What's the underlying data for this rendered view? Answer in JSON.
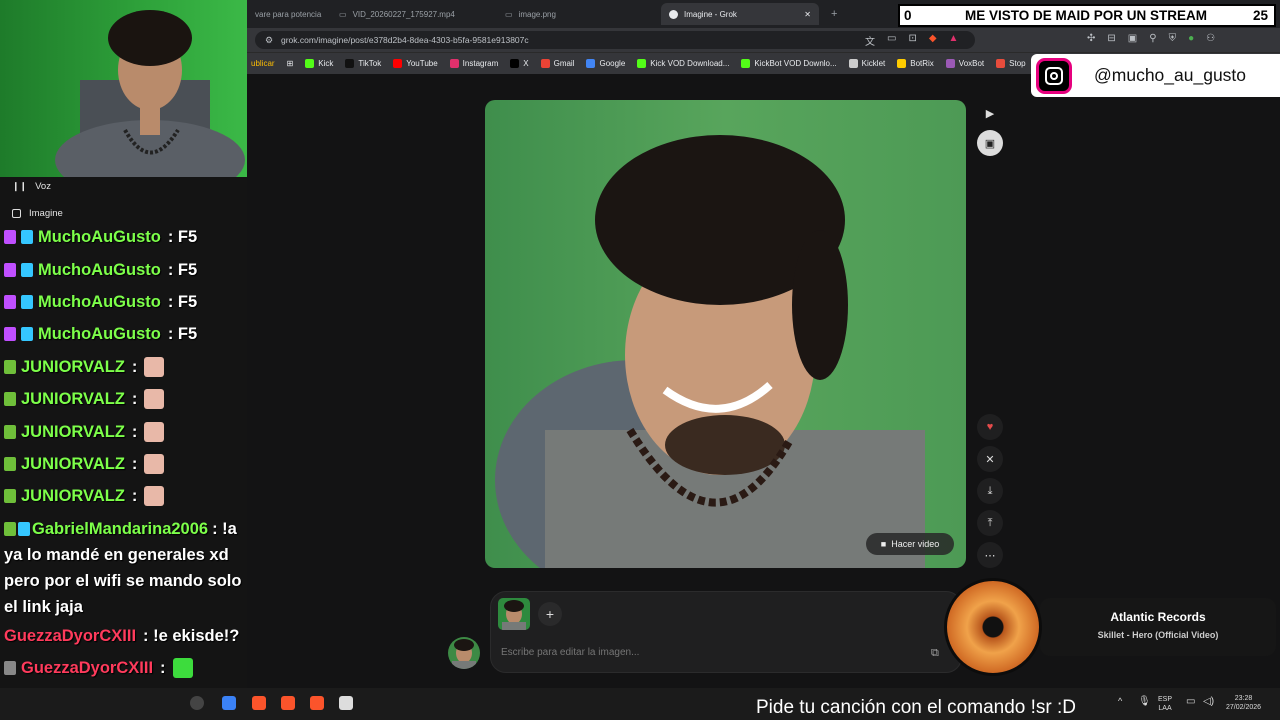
{
  "browser": {
    "tabs": [
      {
        "label": "vare para potencia"
      },
      {
        "label": "VID_20260227_175927.mp4"
      },
      {
        "label": "image.png"
      },
      {
        "label": "Imagine - Grok"
      }
    ],
    "new_tab": "+",
    "url": "grok.com/imagine/post/e378d2b4-8dea-4303-b5fa-9581e913807c",
    "bookmarks_partial": "ublicar",
    "bookmarks": [
      {
        "label": "Kick",
        "color": "#53fc18"
      },
      {
        "label": "TikTok",
        "color": "#111111"
      },
      {
        "label": "YouTube",
        "color": "#ff0000"
      },
      {
        "label": "Instagram",
        "color": "#e1306c"
      },
      {
        "label": "X",
        "color": "#000000"
      },
      {
        "label": "Gmail",
        "color": "#ea4335"
      },
      {
        "label": "Google",
        "color": "#4285f4"
      },
      {
        "label": "Kick VOD Download...",
        "color": "#53fc18"
      },
      {
        "label": "KickBot VOD Downlo...",
        "color": "#53fc18"
      },
      {
        "label": "Kicklet",
        "color": "#cccccc"
      },
      {
        "label": "BotRix",
        "color": "#ffcc00"
      },
      {
        "label": "VoxBot",
        "color": "#9b59b6"
      },
      {
        "label": "Stop",
        "color": "#e74c3c"
      }
    ]
  },
  "sidebar": {
    "voz_label": "Voz",
    "imagine_label": "Imagine"
  },
  "chat": [
    {
      "user": "MuchoAuGusto",
      "user_color": "#7dff4a",
      "text": ": F5",
      "badges": [
        "#c04fff",
        "#35c7ff"
      ]
    },
    {
      "user": "MuchoAuGusto",
      "user_color": "#7dff4a",
      "text": ": F5",
      "badges": [
        "#c04fff",
        "#35c7ff"
      ]
    },
    {
      "user": "MuchoAuGusto",
      "user_color": "#7dff4a",
      "text": ": F5",
      "badges": [
        "#c04fff",
        "#35c7ff"
      ]
    },
    {
      "user": "MuchoAuGusto",
      "user_color": "#7dff4a",
      "text": ": F5",
      "badges": [
        "#c04fff",
        "#35c7ff"
      ]
    },
    {
      "user": "JUNIORVALZ",
      "user_color": "#7dff4a",
      "text": ":",
      "badges": [
        "#6fbf3a"
      ],
      "emote": "anime-emote"
    },
    {
      "user": "JUNIORVALZ",
      "user_color": "#7dff4a",
      "text": ":",
      "badges": [
        "#6fbf3a"
      ],
      "emote": "anime-emote"
    },
    {
      "user": "JUNIORVALZ",
      "user_color": "#7dff4a",
      "text": ":",
      "badges": [
        "#6fbf3a"
      ],
      "emote": "anime-emote"
    },
    {
      "user": "JUNIORVALZ",
      "user_color": "#7dff4a",
      "text": ":",
      "badges": [
        "#6fbf3a"
      ],
      "emote": "anime-emote"
    },
    {
      "user": "JUNIORVALZ",
      "user_color": "#7dff4a",
      "text": ":",
      "badges": [
        "#6fbf3a"
      ],
      "emote": "anime-emote"
    },
    {
      "user": "GabrielMandarina2006",
      "user_color": "#7dff4a",
      "text": ": !a ya lo mandé en generales xd pero por el wifi se mando solo el link jaja",
      "badges": [
        "#6fbf3a",
        "#35c7ff"
      ],
      "wrap": true
    },
    {
      "user": "GuezzaDyorCXIII",
      "user_color": "#ff3b5c",
      "text": ": !e ekisde!?",
      "badges": []
    },
    {
      "user": "GuezzaDyorCXIII",
      "user_color": "#ff3b5c",
      "text": ":",
      "badges": [
        "#888888"
      ],
      "emote": "green-cat-emote"
    },
    {
      "user": "GuezzaDyorCXIII",
      "user_color": "#ff3b5c",
      "text": ":",
      "badges": [],
      "emote": "green-cat-emote"
    }
  ],
  "grok": {
    "hacer_video": "Hacer video",
    "prompt_placeholder": "Escribe para editar la imagen...",
    "plus": "+"
  },
  "overlays": {
    "ticker_left": "0",
    "ticker_title": "ME VISTO DE MAID POR UN STREAM",
    "ticker_right": "25",
    "instagram_handle": "@mucho_au_gusto",
    "music_artist": "Atlantic Records",
    "music_title": "Skillet - Hero (Official Video)",
    "song_request": "Pide tu canción con el comando !sr :D"
  },
  "tray": {
    "lang": "ESP",
    "lang2": "LAA",
    "time": "23:28",
    "date": "27/02/2026"
  }
}
